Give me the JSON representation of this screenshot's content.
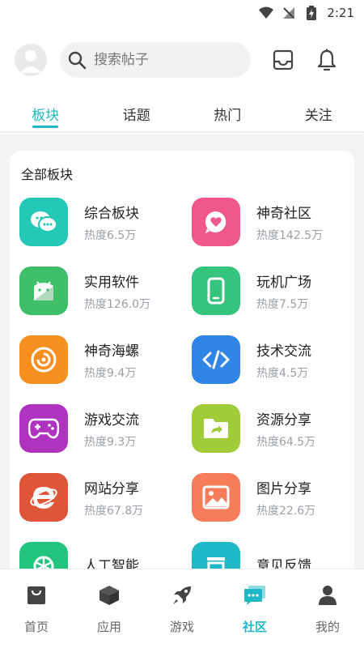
{
  "status": {
    "time": "2:21"
  },
  "header": {
    "search_placeholder": "搜索帖子"
  },
  "tabs": [
    {
      "label": "板块",
      "active": true
    },
    {
      "label": "话题",
      "active": false
    },
    {
      "label": "热门",
      "active": false
    },
    {
      "label": "关注",
      "active": false
    }
  ],
  "section": {
    "title": "全部板块"
  },
  "boards": [
    {
      "name": "综合板块",
      "heat": "热度6.5万",
      "color": "#23c9b6",
      "icon": "chat-bubbles-icon"
    },
    {
      "name": "神奇社区",
      "heat": "热度142.5万",
      "color": "#f0588a",
      "icon": "heart-bubble-icon"
    },
    {
      "name": "实用软件",
      "heat": "热度126.0万",
      "color": "#3fbf6a",
      "icon": "android-icon"
    },
    {
      "name": "玩机广场",
      "heat": "热度7.5万",
      "color": "#35c47e",
      "icon": "phone-icon"
    },
    {
      "name": "神奇海螺",
      "heat": "热度9.4万",
      "color": "#f7901e",
      "icon": "conch-icon"
    },
    {
      "name": "技术交流",
      "heat": "热度4.5万",
      "color": "#2f86e6",
      "icon": "code-icon"
    },
    {
      "name": "游戏交流",
      "heat": "热度9.3万",
      "color": "#b033c0",
      "icon": "gamepad-icon"
    },
    {
      "name": "资源分享",
      "heat": "热度64.5万",
      "color": "#9fcc38",
      "icon": "folder-share-icon"
    },
    {
      "name": "网站分享",
      "heat": "热度67.8万",
      "color": "#de5538",
      "icon": "browser-e-icon"
    },
    {
      "name": "图片分享",
      "heat": "热度22.6万",
      "color": "#f77d5a",
      "icon": "image-icon"
    },
    {
      "name": "人工智能",
      "heat": "",
      "color": "#22c47e",
      "icon": "ai-knot-icon"
    },
    {
      "name": "意见反馈",
      "heat": "",
      "color": "#1eb8c6",
      "icon": "feedback-icon"
    }
  ],
  "nav": [
    {
      "label": "首页",
      "icon": "bag-icon",
      "active": false
    },
    {
      "label": "应用",
      "icon": "cube-icon",
      "active": false
    },
    {
      "label": "游戏",
      "icon": "rocket-icon",
      "active": false
    },
    {
      "label": "社区",
      "icon": "community-chat-icon",
      "active": true
    },
    {
      "label": "我的",
      "icon": "person-icon",
      "active": false
    }
  ],
  "colors": {
    "accent": "#1eb8c6",
    "icon_gray": "#444444"
  }
}
